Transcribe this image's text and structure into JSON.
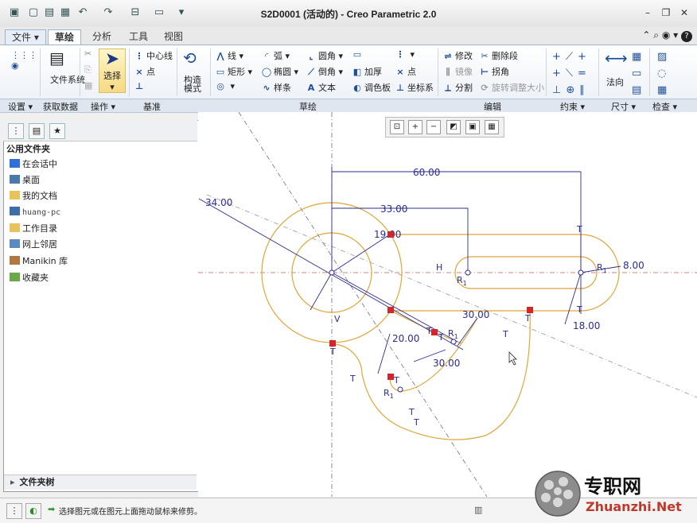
{
  "window": {
    "title": "S2D0001 (活动的) - Creo Parametric 2.0",
    "controls": [
      "minimize",
      "restore",
      "close"
    ]
  },
  "tabs": [
    "文件",
    "草绘",
    "分析",
    "工具",
    "视图"
  ],
  "active_tab": "草绘",
  "ribbon": {
    "setup": {
      "btn": "文件系统"
    },
    "get_data": {
      "label": "获取数据"
    },
    "operations": {
      "select": "选择"
    },
    "datum": {
      "centerline": "中心线",
      "point": "点"
    },
    "construct": {
      "label": "构造模式"
    },
    "sketch": {
      "line": "线",
      "arc": "弧",
      "fillet": "圆角",
      "rect": "矩形",
      "ellipse": "椭圆",
      "chamfer": "倒角",
      "thicken": "加厚",
      "point": "点",
      "spline": "样条",
      "text": "文本",
      "palette": "调色板",
      "coordsys": "坐标系"
    },
    "edit": {
      "modify": "修改",
      "delete_segment": "删除段",
      "mirror": "镜像",
      "corner": "拐角",
      "divide": "分割",
      "rotate_resize": "旋转调整大小"
    },
    "dimension": {
      "normal": "法向"
    }
  },
  "groups": [
    "设置",
    "获取数据",
    "操作",
    "基准",
    "草绘",
    "编辑",
    "约束",
    "尺寸",
    "检查"
  ],
  "left_panel": {
    "header": "公用文件夹",
    "items": [
      "在会话中",
      "桌面",
      "我的文档",
      "huang-pc",
      "工作目录",
      "网上邻居",
      "Manikin 库",
      "收藏夹"
    ],
    "footer": "文件夹树"
  },
  "sketch": {
    "dims": {
      "d60": "60.00",
      "d33": "33.00",
      "d34": "34.00",
      "d19": "19.00",
      "d8": "8.00",
      "d18": "18.00",
      "d30a": "30.00",
      "d20": "20.00",
      "d30b": "30.00"
    },
    "labels": {
      "H": "H",
      "V": "V",
      "R1": "R",
      "R1sub": "1",
      "T": "T"
    },
    "colors": {
      "geometry": "#e1a53a",
      "dimension": "#2b2c90",
      "constraint": "#2b2c90",
      "centerline": "#8a8a8a",
      "selected_point": "#d3262b"
    }
  },
  "status": {
    "message": "选择图元或在图元上面拖动鼠标来修剪。"
  },
  "watermark": {
    "cn": "专职网",
    "en": "Zhuanzhi.Net"
  }
}
